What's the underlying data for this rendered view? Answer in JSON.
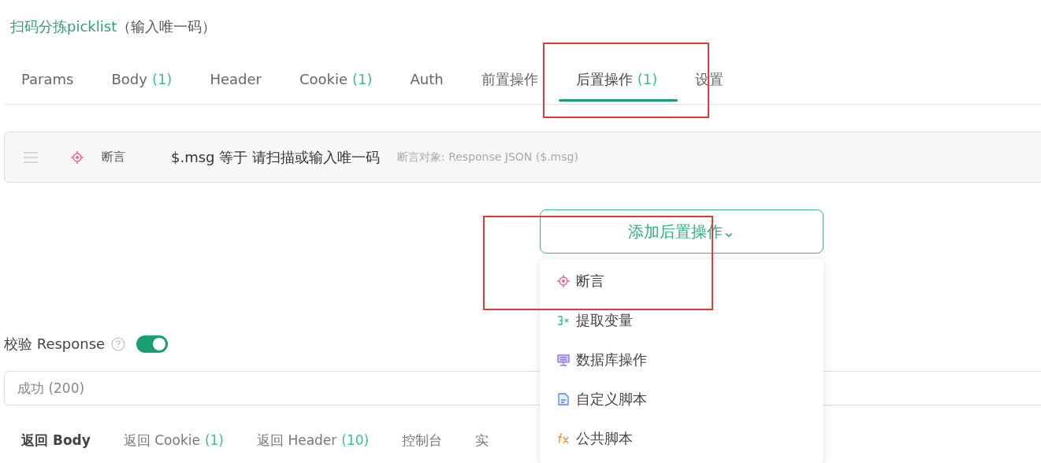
{
  "title": {
    "name": "扫码分拣picklist",
    "hint": "（输入唯一码）"
  },
  "tabs": [
    {
      "label": "Params",
      "selected": false,
      "highlighted": false
    },
    {
      "label": "Body",
      "count": "(1)",
      "selected": false,
      "highlighted": false
    },
    {
      "label": "Header",
      "selected": false,
      "highlighted": false
    },
    {
      "label": "Cookie",
      "count": "(1)",
      "selected": false,
      "highlighted": false
    },
    {
      "label": "Auth",
      "selected": false,
      "highlighted": false
    },
    {
      "label": "前置操作",
      "selected": false,
      "highlighted": false
    },
    {
      "label": "后置操作",
      "count": "(1)",
      "selected": true,
      "highlighted": true
    },
    {
      "label": "设置",
      "selected": false,
      "highlighted": false
    }
  ],
  "operations": [
    {
      "kind": "assert",
      "type": "断言",
      "expression": "$.msg 等于 请扫描或输入唯一码",
      "target": "断言对象: Response JSON ($.msg)"
    }
  ],
  "add_button": {
    "label": "添加后置操作",
    "caret": "⌄"
  },
  "menu": [
    {
      "kind": "assert",
      "label": "断言",
      "highlighted": true
    },
    {
      "kind": "extract",
      "label": "提取变量",
      "highlighted": false
    },
    {
      "kind": "database",
      "label": "数据库操作",
      "highlighted": false
    },
    {
      "kind": "script",
      "label": "自定义脚本",
      "highlighted": false
    },
    {
      "kind": "common",
      "label": "公共脚本",
      "highlighted": false
    }
  ],
  "validate": {
    "label": "校验 Response",
    "on": true,
    "value": "成功 (200)"
  },
  "response_tabs": [
    {
      "label": "返回 Body",
      "selected": true
    },
    {
      "label": "返回 Cookie",
      "count": "(1)",
      "selected": false
    },
    {
      "label": "返回 Header",
      "count": "(10)",
      "selected": false
    },
    {
      "label": "控制台",
      "selected": false
    },
    {
      "label": "实",
      "selected": false
    }
  ]
}
